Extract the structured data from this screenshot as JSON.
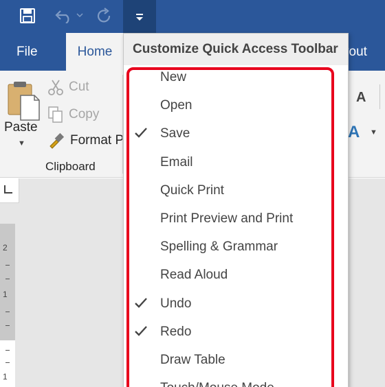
{
  "title_bar": {
    "bg_color": "#2b579a",
    "quick_access": {
      "save_icon": "save-icon",
      "undo_icon": "undo-icon",
      "redo_icon": "redo-icon",
      "customize_icon": "customize-dropdown-icon"
    }
  },
  "tabs": {
    "file": "File",
    "home": "Home",
    "layout_partial": "yout"
  },
  "ribbon": {
    "paste_label": "Paste",
    "cut_label": "Cut",
    "copy_label": "Copy",
    "format_painter_label": "Format P",
    "group_label": "Clipboard",
    "font_grow_glyph": "A",
    "text_effects_glyph": "A"
  },
  "dropdown": {
    "header": "Customize Quick Access Toolbar",
    "items": [
      {
        "label": "New",
        "checked": false
      },
      {
        "label": "Open",
        "checked": false
      },
      {
        "label": "Save",
        "checked": true
      },
      {
        "label": "Email",
        "checked": false
      },
      {
        "label": "Quick Print",
        "checked": false
      },
      {
        "label": "Print Preview and Print",
        "checked": false
      },
      {
        "label": "Spelling & Grammar",
        "checked": false
      },
      {
        "label": "Read Aloud",
        "checked": false
      },
      {
        "label": "Undo",
        "checked": true
      },
      {
        "label": "Redo",
        "checked": true
      },
      {
        "label": "Draw Table",
        "checked": false
      },
      {
        "label": "Touch/Mouse Mode",
        "checked": false
      }
    ]
  },
  "ruler": {
    "numbers": [
      "2",
      "1",
      "1"
    ]
  },
  "colors": {
    "accent": "#2b579a",
    "highlight_border": "#e8001c",
    "menu_text": "#444444"
  }
}
